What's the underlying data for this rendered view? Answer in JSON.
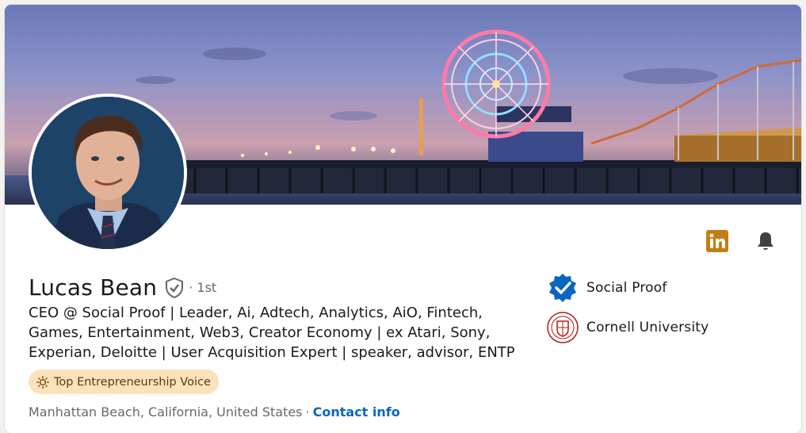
{
  "profile": {
    "name": "Lucas Bean",
    "degree": "· 1st",
    "headline": "CEO @ Social Proof | Leader, Ai, Adtech, Analytics, AiO, Fintech, Games, Entertainment, Web3, Creator Economy | ex Atari, Sony, Experian, Deloitte | User Acquisition Expert | speaker, advisor, ENTP",
    "badge": "Top Entrepreneurship Voice",
    "location": "Manhattan Beach, California, United States",
    "separator": "·",
    "contact_link": "Contact info"
  },
  "organizations": [
    {
      "label": "Social Proof",
      "icon": "verified-badge-icon"
    },
    {
      "label": "Cornell University",
      "icon": "cornell-seal-icon"
    }
  ],
  "actions": {
    "linkedin_icon": "linkedin-icon",
    "bell_icon": "bell-icon"
  },
  "colors": {
    "link": "#0a66c2",
    "badge_bg": "#fce2ba",
    "linkedin_orange": "#c37d16",
    "verified_blue": "#0a66c2",
    "cornell_red": "#b31b1b"
  }
}
